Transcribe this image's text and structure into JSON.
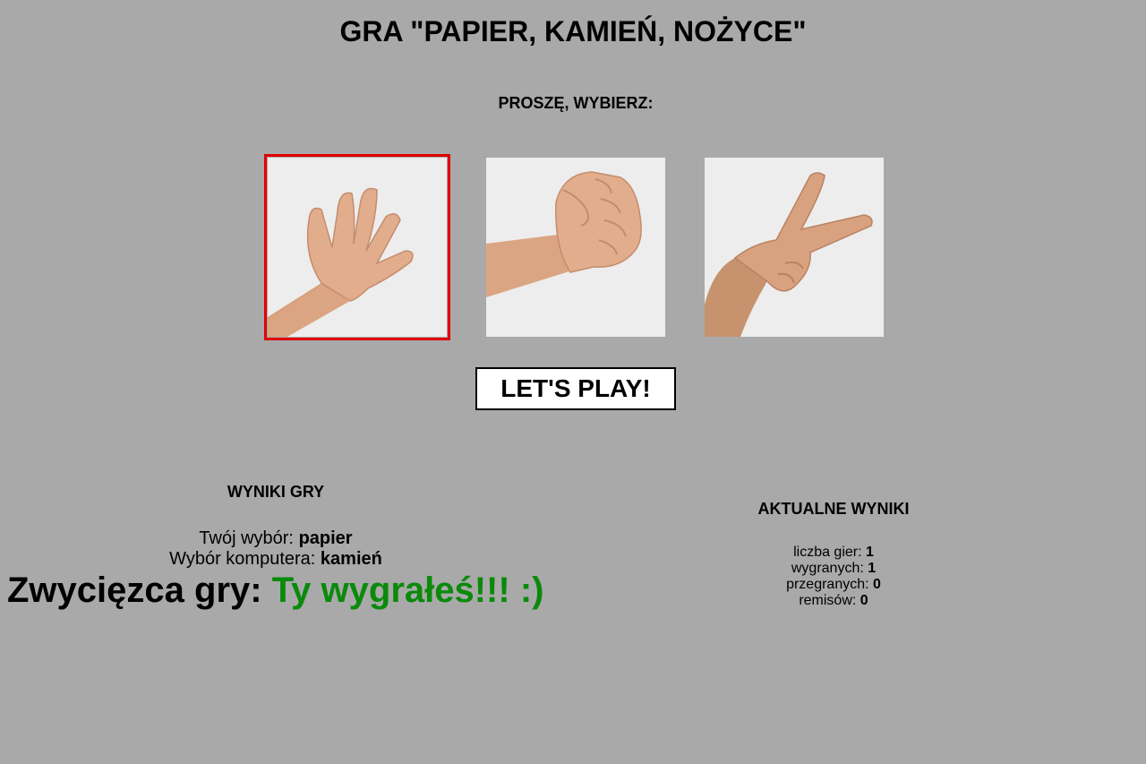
{
  "title": "GRA \"PAPIER, KAMIEŃ, NOŻYCE\"",
  "prompt": "PROSZĘ, WYBIERZ:",
  "choices": [
    {
      "id": "papier",
      "selected": true
    },
    {
      "id": "kamień",
      "selected": false
    },
    {
      "id": "nożyce",
      "selected": false
    }
  ],
  "colors": {
    "background": "#a9a9a9",
    "selected_border": "#e00000",
    "win_text": "#0a8a0a"
  },
  "play_button": "LET'S PLAY!",
  "results": {
    "title": "WYNIKI GRY",
    "your_choice_label": "Twój wybór:",
    "your_choice": "papier",
    "computer_choice_label": "Wybór komputera:",
    "computer_choice": "kamień",
    "winner_label": "Zwycięzca gry:",
    "winner_text": "Ty wygrałeś!!! :)"
  },
  "stats": {
    "title": "AKTUALNE WYNIKI",
    "games_label": "liczba gier:",
    "games": "1",
    "wins_label": "wygranych:",
    "wins": "1",
    "losses_label": "przegranych:",
    "losses": "0",
    "draws_label": "remisów:",
    "draws": "0"
  }
}
